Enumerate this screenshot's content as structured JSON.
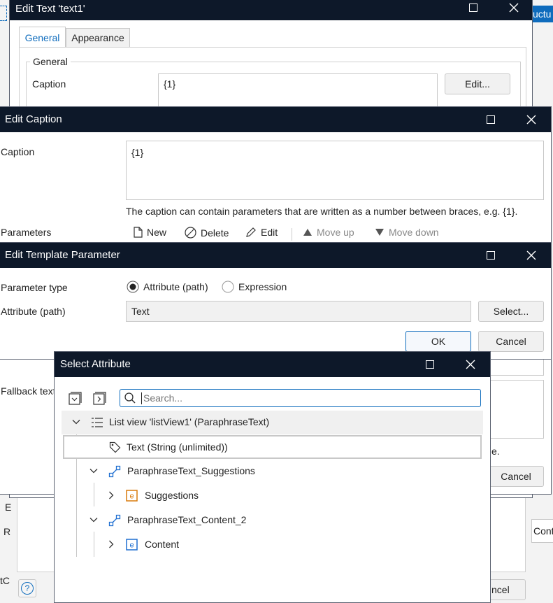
{
  "background": {
    "right_tab_label": "uctu",
    "left_snippets": [
      "E",
      "R",
      "tC"
    ],
    "right_snippets": [
      "e.",
      "Cont"
    ],
    "cancel_right": "Cancel",
    "cancel_bottom": "ncel",
    "help_symbol": "?",
    "fallback_label": "Fallback text"
  },
  "edit_text": {
    "title": "Edit Text 'text1'",
    "tabs": [
      "General",
      "Appearance"
    ],
    "group_label": "General",
    "caption_label": "Caption",
    "caption_value": "{1}",
    "edit_button": "Edit..."
  },
  "edit_caption": {
    "title": "Edit Caption",
    "caption_label": "Caption",
    "caption_value": "{1}",
    "hint": "The caption can contain parameters that are written as a number between braces, e.g. {1}.",
    "parameters_label": "Parameters",
    "toolbar": {
      "new": "New",
      "delete": "Delete",
      "edit": "Edit",
      "move_up": "Move up",
      "move_down": "Move down"
    }
  },
  "edit_template_parameter": {
    "title": "Edit Template Parameter",
    "parameter_type_label": "Parameter type",
    "option_attribute": "Attribute (path)",
    "option_expression": "Expression",
    "attribute_label": "Attribute (path)",
    "attribute_value": "Text",
    "select_button": "Select...",
    "ok_button": "OK",
    "cancel_button": "Cancel"
  },
  "select_attribute": {
    "title": "Select Attribute",
    "search_placeholder": "Search...",
    "tree": [
      {
        "label": "List view 'listView1' (ParaphraseText)",
        "icon": "list-view-icon"
      },
      {
        "label": "Text (String (unlimited))",
        "icon": "tag-icon"
      },
      {
        "label": "ParaphraseText_Suggestions",
        "icon": "association-icon"
      },
      {
        "label": "Suggestions",
        "icon": "entity-icon"
      },
      {
        "label": "ParaphraseText_Content_2",
        "icon": "association-icon"
      },
      {
        "label": "Content",
        "icon": "entity-icon"
      }
    ],
    "colors": {
      "accent": "#0f6cbd",
      "entity_orange": "#d97a0b",
      "entity_blue": "#1f6fd1",
      "titlebar": "#0d1829"
    }
  }
}
